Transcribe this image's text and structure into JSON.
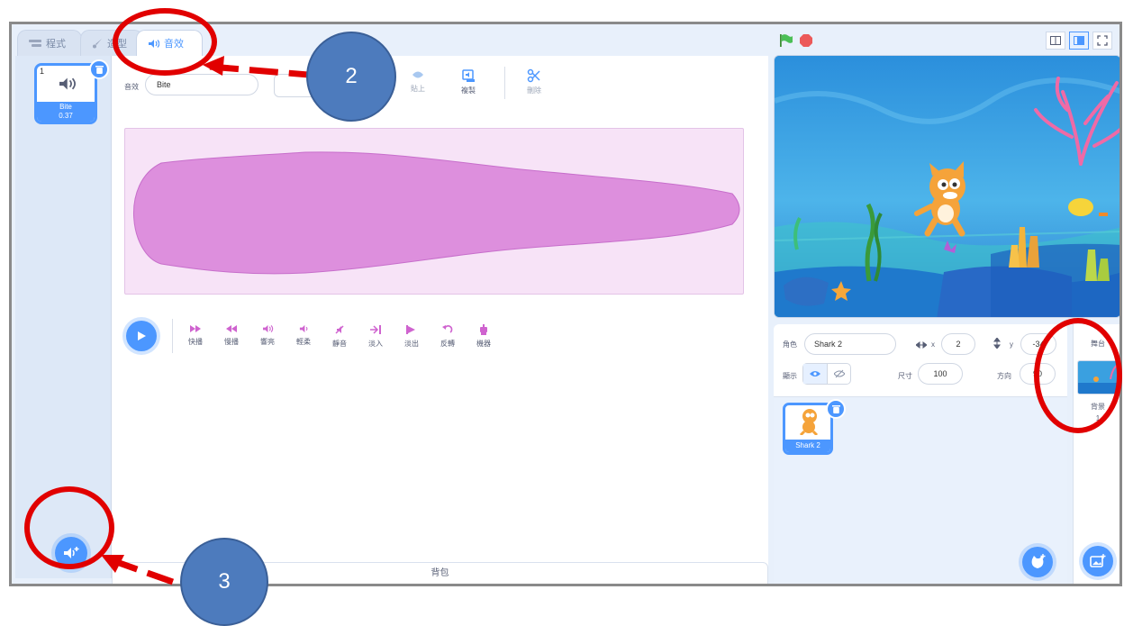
{
  "tabs": [
    {
      "label": "程式",
      "icon": "code-icon"
    },
    {
      "label": "造型",
      "icon": "brush-icon"
    },
    {
      "label": "音效",
      "icon": "speaker-icon"
    }
  ],
  "sound_list": {
    "number": "1",
    "name": "Bite",
    "duration": "0.37"
  },
  "editor": {
    "name_label": "音效",
    "name_value": "Bite",
    "tools": [
      "貼上",
      "複製",
      "刪除"
    ],
    "effects": [
      "快播",
      "慢播",
      "響亮",
      "輕柔",
      "靜音",
      "淡入",
      "淡出",
      "反轉",
      "機器"
    ]
  },
  "backpack": "背包",
  "sprite_info": {
    "sprite_label": "角色",
    "sprite_name": "Shark 2",
    "x_label": "x",
    "x_value": "2",
    "y_label": "y",
    "y_value": "-34",
    "show_label": "顯示",
    "size_label": "尺寸",
    "size_value": "100",
    "direction_label": "方向",
    "direction_value": "90"
  },
  "sprite_tile": {
    "name": "Shark 2"
  },
  "stage_panel": {
    "title": "舞台",
    "backdrops_label": "背景",
    "backdrops_count": "1"
  },
  "annotations": {
    "bubble_2": "2",
    "bubble_3": "3"
  },
  "colors": {
    "accent": "#4c97ff",
    "sound_wave": "#dd8fdd",
    "annotation_red": "#e10000",
    "bubble_blue": "#4d7bbd"
  }
}
